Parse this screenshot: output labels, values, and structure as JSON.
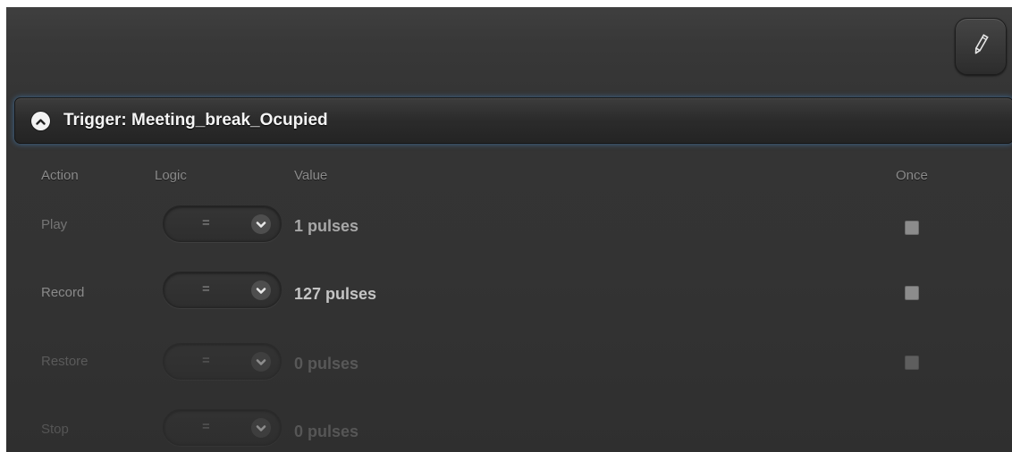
{
  "trigger": {
    "title": "Trigger: Meeting_break_Ocupied",
    "collapse_icon": "chevron-up-icon",
    "edit_icon": "pencil-icon"
  },
  "columns": {
    "action": "Action",
    "logic": "Logic",
    "value": "Value",
    "once": "Once"
  },
  "rows": [
    {
      "action": "Play",
      "logic": "=",
      "value": "1 pulses",
      "once": false,
      "enabled": true
    },
    {
      "action": "Record",
      "logic": "=",
      "value": "127 pulses",
      "once": false,
      "enabled": true
    },
    {
      "action": "Restore",
      "logic": "=",
      "value": "0 pulses",
      "once": false,
      "enabled": false
    },
    {
      "action": "Stop",
      "logic": "=",
      "value": "0 pulses",
      "once": false,
      "enabled": false
    }
  ],
  "colors": {
    "header_glow": "#4482be",
    "text_primary": "#f5f5f5",
    "text_muted": "#8a8a8a"
  }
}
